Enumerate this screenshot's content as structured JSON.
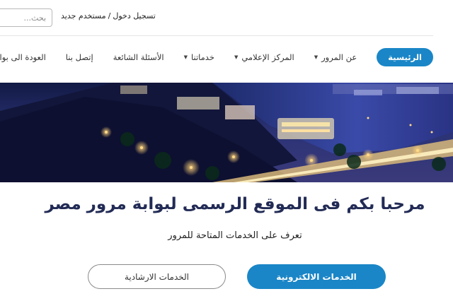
{
  "header": {
    "search_placeholder": "بحث...",
    "login_label": "تسجيل دخول",
    "separator": "/",
    "new_user_label": "مستخدم جديد"
  },
  "nav": {
    "items": [
      {
        "label": "الرئيسية",
        "active": true,
        "dropdown": false
      },
      {
        "label": "عن المرور",
        "active": false,
        "dropdown": true
      },
      {
        "label": "المركز الإعلامي",
        "active": false,
        "dropdown": true
      },
      {
        "label": "خدماتنا",
        "active": false,
        "dropdown": true
      },
      {
        "label": "الأسئلة الشائعة",
        "active": false,
        "dropdown": false
      },
      {
        "label": "إتصل بنا",
        "active": false,
        "dropdown": false
      },
      {
        "label": "العودة الى بوابة الو",
        "active": false,
        "dropdown": false
      }
    ]
  },
  "hero": {
    "welcome_title": "مرحبا بكم فى الموقع الرسمى لبوابة مرور مصر",
    "subtitle": "تعرف على الخدمات المتاحة للمرور"
  },
  "actions": {
    "primary_label": "الخدمات الالكترونية",
    "secondary_label": "الخدمات الارشادية"
  },
  "colors": {
    "accent": "#1a86c7",
    "title": "#222b55"
  }
}
